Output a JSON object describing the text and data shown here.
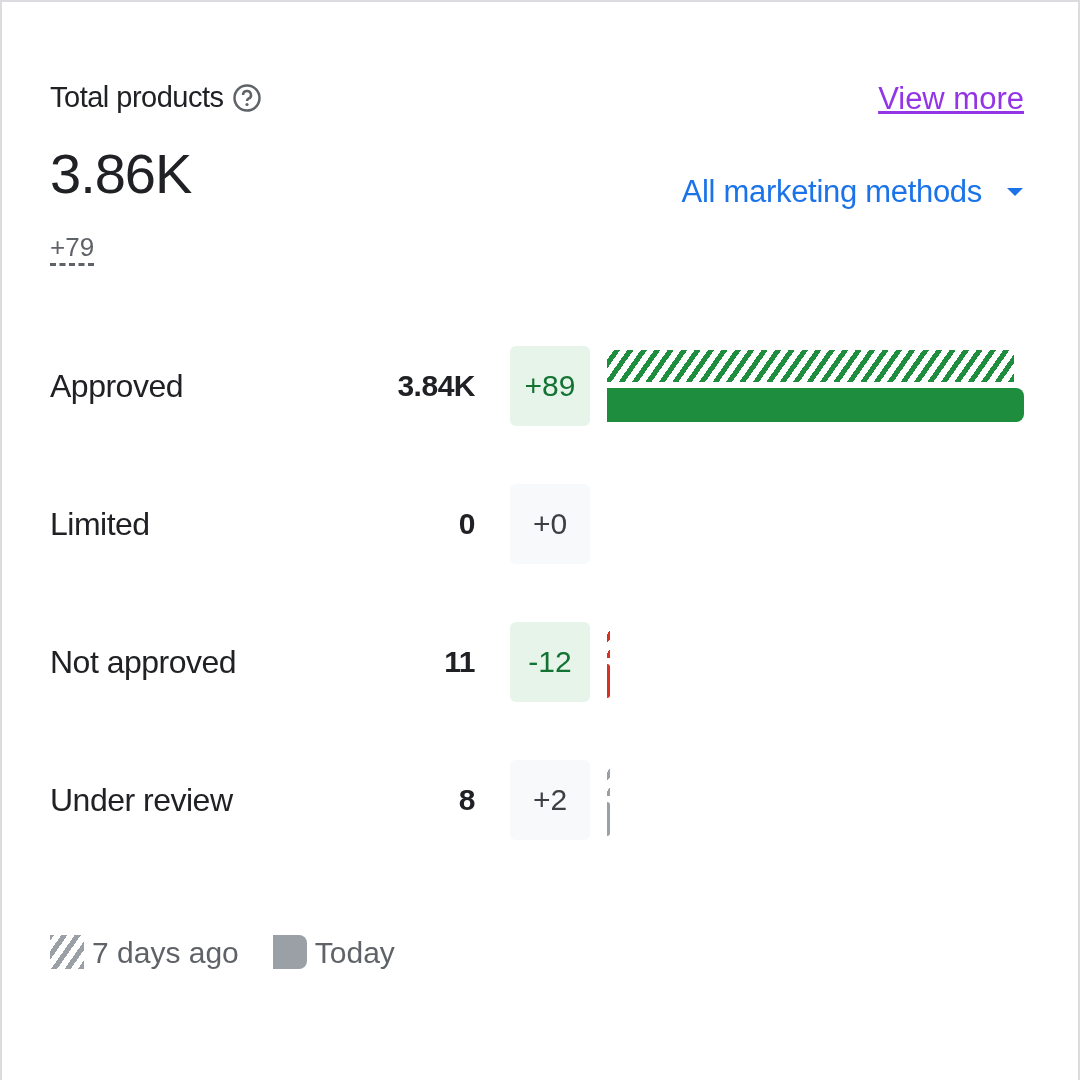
{
  "header": {
    "title": "Total products",
    "total": "3.86K",
    "change": "+79",
    "link": "View more",
    "filter": "All marketing methods"
  },
  "rows": [
    {
      "label": "Approved",
      "count": "3.84K",
      "delta": "+89",
      "kind": "positive",
      "color": "#1e8e3e"
    },
    {
      "label": "Limited",
      "count": "0",
      "delta": "+0",
      "kind": "neutral"
    },
    {
      "label": "Not approved",
      "count": "11",
      "delta": "-12",
      "kind": "positive",
      "color": "#d93025"
    },
    {
      "label": "Under review",
      "count": "8",
      "delta": "+2",
      "kind": "neutral",
      "color": "#9aa0a6"
    }
  ],
  "legend": [
    {
      "kind": "hatched",
      "label": "7 days ago"
    },
    {
      "kind": "solid",
      "label": "Today"
    }
  ]
}
